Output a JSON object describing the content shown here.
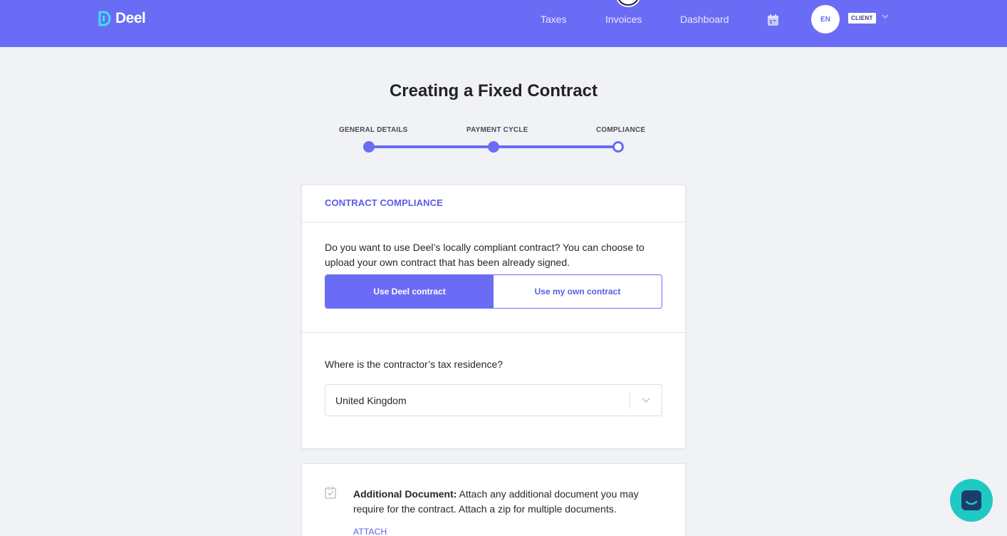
{
  "brand": {
    "name": "Deel"
  },
  "nav": {
    "links": [
      "Taxes",
      "Invoices",
      "Dashboard"
    ],
    "language": "EN",
    "role_badge": "CLIENT"
  },
  "page": {
    "title": "Creating a Fixed Contract"
  },
  "stepper": {
    "steps": [
      "GENERAL DETAILS",
      "PAYMENT CYCLE",
      "COMPLIANCE"
    ],
    "current_step": 3
  },
  "compliance_card": {
    "header": "CONTRACT COMPLIANCE",
    "question": "Do you want to use Deel’s locally compliant contract? You can choose to upload your own contract that has been already signed.",
    "options": [
      "Use Deel contract",
      "Use my own contract"
    ],
    "selected_option": "Use Deel contract",
    "tax_question": "Where is the contractor’s tax residence?",
    "tax_residence_value": "United Kingdom"
  },
  "document_card": {
    "title": "Additional Document:",
    "description": " Attach any additional document you may require for the contract. Attach a zip for multiple documents.",
    "attach_label": "ATTACH"
  },
  "colors": {
    "accent": "#6a6cf5",
    "chat": "#1fc9c3",
    "background": "#f1f2f6"
  },
  "icons": [
    "deel-logo-icon",
    "calendar-icon",
    "chevron-down-icon",
    "document-check-icon",
    "chat-icon"
  ]
}
